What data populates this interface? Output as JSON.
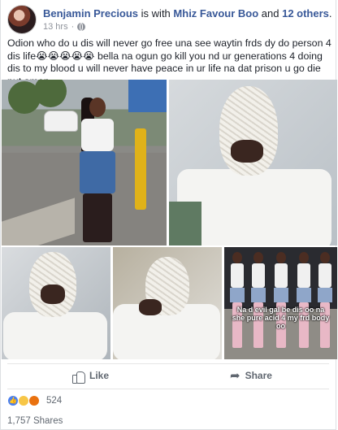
{
  "post": {
    "author": "Benjamin Precious",
    "with_text": "is with",
    "tagged": "Mhiz Favour Boo",
    "and_text": "and",
    "others": "12 others",
    "others_end": ".",
    "time": "13 hrs",
    "time_sep": "·",
    "privacy_icon": "globe-icon",
    "text": "Odion who do u dis will never go free una see waytin frds dy do person 4 dis life😭😭😭😭😭 bella na ogun go kill you nd ur generations 4 doing dis to my blood u will never have peace in ur life na dat prison u go die put amen"
  },
  "photos": {
    "caption": "Na d evil gal be dis oo na she pure acid 4 my frd body oo"
  },
  "actions": {
    "like_label": "Like",
    "share_label": "Share"
  },
  "reactions": {
    "types": [
      "like-icon",
      "wow-icon",
      "angry-icon"
    ],
    "count": "524"
  },
  "shares": {
    "label": "1,757 Shares"
  },
  "colors": {
    "link": "#385898",
    "muted": "#90949c",
    "like_reaction": "#4a7ff0"
  }
}
